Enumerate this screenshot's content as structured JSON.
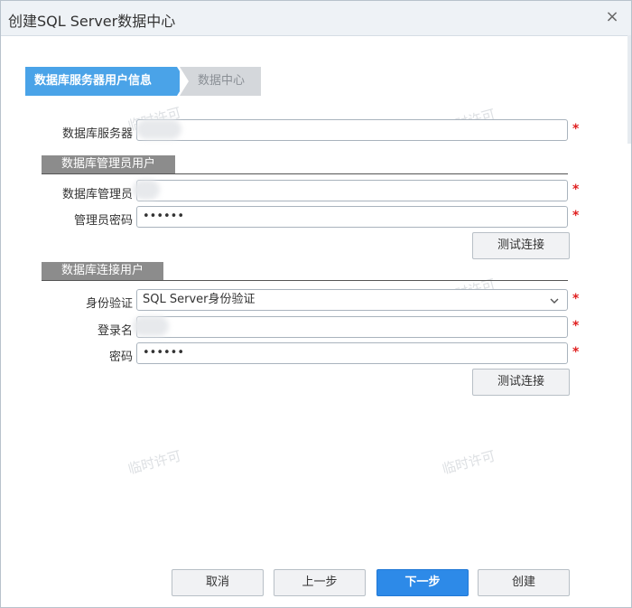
{
  "dialog": {
    "title": "创建SQL Server数据中心",
    "close_glyph": "×"
  },
  "steps": [
    {
      "label": "数据库服务器用户信息",
      "state": "active"
    },
    {
      "label": "数据中心",
      "state": "inactive"
    }
  ],
  "server": {
    "label": "数据库服务器",
    "value": "",
    "required_mark": "*"
  },
  "admin_section": {
    "title": "数据库管理员用户",
    "admin_label": "数据库管理员",
    "admin_value": "",
    "password_label": "管理员密码",
    "password_value": "••••••",
    "required_mark": "*",
    "test_button": "测试连接"
  },
  "connect_section": {
    "title": "数据库连接用户",
    "auth_label": "身份验证",
    "auth_value": "SQL Server身份验证",
    "login_label": "登录名",
    "login_value": "",
    "password_label": "密码",
    "password_value": "••••••",
    "required_mark": "*",
    "test_button": "测试连接"
  },
  "footer": {
    "cancel": "取消",
    "prev": "上一步",
    "next": "下一步",
    "create": "创建"
  },
  "watermark_text": "临时许可",
  "colors": {
    "accent": "#2d8ae8",
    "step_active": "#4aa3e8",
    "required": "#e02020",
    "section_tab": "#8c8c8c"
  },
  "icons": {
    "close": "close-icon",
    "dropdown": "chevron-down-icon"
  }
}
